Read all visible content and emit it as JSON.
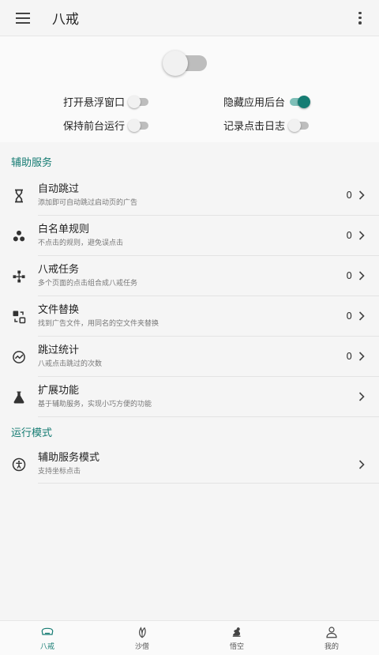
{
  "app": {
    "title": "八戒"
  },
  "master_switch": {
    "on": false
  },
  "options": [
    {
      "label": "打开悬浮窗口",
      "on": false
    },
    {
      "label": "隐藏应用后台",
      "on": true
    },
    {
      "label": "保持前台运行",
      "on": false
    },
    {
      "label": "记录点击日志",
      "on": false
    }
  ],
  "sections": {
    "assist": {
      "title": "辅助服务",
      "items": [
        {
          "title": "自动跳过",
          "subtitle": "添加即可自动跳过启动页的广告",
          "count": "0",
          "icon": "hourglass-icon"
        },
        {
          "title": "白名单规则",
          "subtitle": "不点击的规则，避免误点击",
          "count": "0",
          "icon": "cluster-dots-icon"
        },
        {
          "title": "八戒任务",
          "subtitle": "多个页面的点击组合成八戒任务",
          "count": "0",
          "icon": "flow-icon"
        },
        {
          "title": "文件替换",
          "subtitle": "找到广告文件，用同名的空文件夹替换",
          "count": "0",
          "icon": "swap-icon"
        },
        {
          "title": "跳过统计",
          "subtitle": "八戒点击跳过的次数",
          "count": "0",
          "icon": "stats-icon"
        },
        {
          "title": "扩展功能",
          "subtitle": "基于辅助服务，实现小巧方便的功能",
          "count": "",
          "icon": "flask-icon"
        }
      ]
    },
    "mode": {
      "title": "运行模式",
      "items": [
        {
          "title": "辅助服务模式",
          "subtitle": "支持坐标点击",
          "count": "",
          "icon": "accessibility-icon"
        }
      ]
    }
  },
  "bottom_nav": [
    {
      "label": "八戒",
      "icon": "bajie-icon",
      "active": true
    },
    {
      "label": "沙僧",
      "icon": "leaf-icon",
      "active": false
    },
    {
      "label": "悟空",
      "icon": "monkey-icon",
      "active": false
    },
    {
      "label": "我的",
      "icon": "person-icon",
      "active": false
    }
  ],
  "colors": {
    "accent": "#167c73",
    "accent_light": "#7fbfb8",
    "background": "#f5f5f5"
  }
}
